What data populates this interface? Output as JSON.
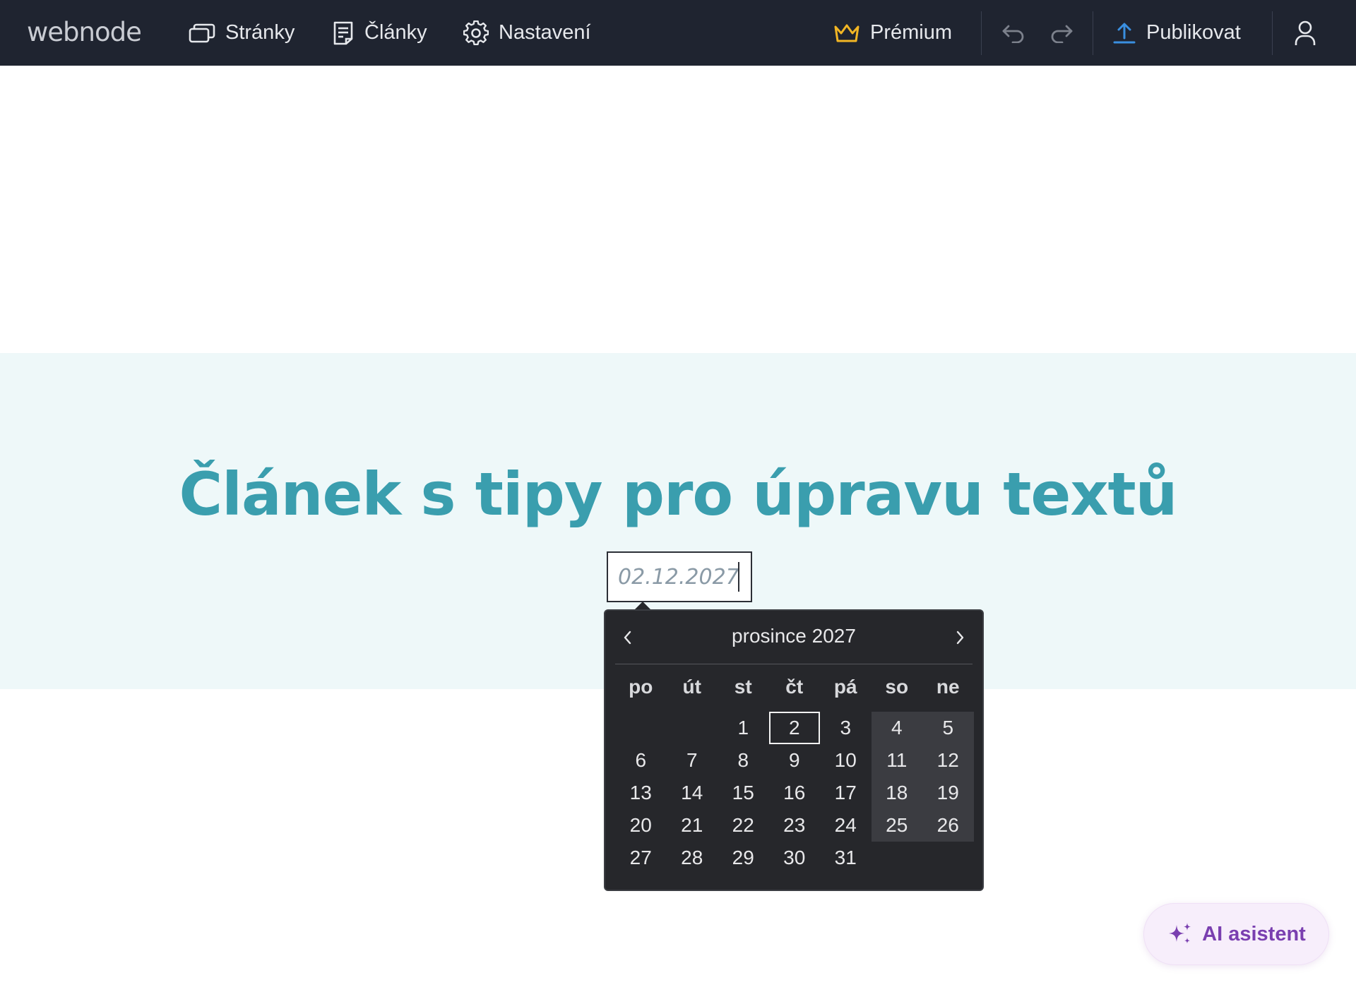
{
  "topbar": {
    "logo": "webnode",
    "nav": {
      "pages": "Stránky",
      "articles": "Články",
      "settings": "Nastavení"
    },
    "premium": "Prémium",
    "publish": "Publikovat",
    "icons": {
      "pages": "pages-icon",
      "articles": "article-icon",
      "settings": "gear-icon",
      "premium": "crown-icon",
      "undo": "undo-icon",
      "redo": "redo-icon",
      "publish": "upload-icon",
      "user": "user-icon"
    }
  },
  "article": {
    "title": "Článek s tipy pro úpravu textů",
    "date_value": "02.12.2027"
  },
  "calendar": {
    "month_label": "prosince 2027",
    "weekdays": [
      "po",
      "út",
      "st",
      "čt",
      "pá",
      "so",
      "ne"
    ],
    "selected_day": "2",
    "days": [
      "",
      "",
      "1",
      "2",
      "3",
      "4",
      "5",
      "6",
      "7",
      "8",
      "9",
      "10",
      "11",
      "12",
      "13",
      "14",
      "15",
      "16",
      "17",
      "18",
      "19",
      "20",
      "21",
      "22",
      "23",
      "24",
      "25",
      "26",
      "27",
      "28",
      "29",
      "30",
      "31",
      "",
      ""
    ]
  },
  "ai_assistant": {
    "label": "AI asistent",
    "icon": "sparkle-icon"
  },
  "colors": {
    "topbar_bg": "#1f2430",
    "title": "#3a9eae",
    "hero_bg": "#eef8f9",
    "calendar_bg": "#26272b",
    "premium_crown": "#f2b624",
    "publish_icon": "#3a8fe0",
    "ai_accent": "#7a3fb0"
  }
}
